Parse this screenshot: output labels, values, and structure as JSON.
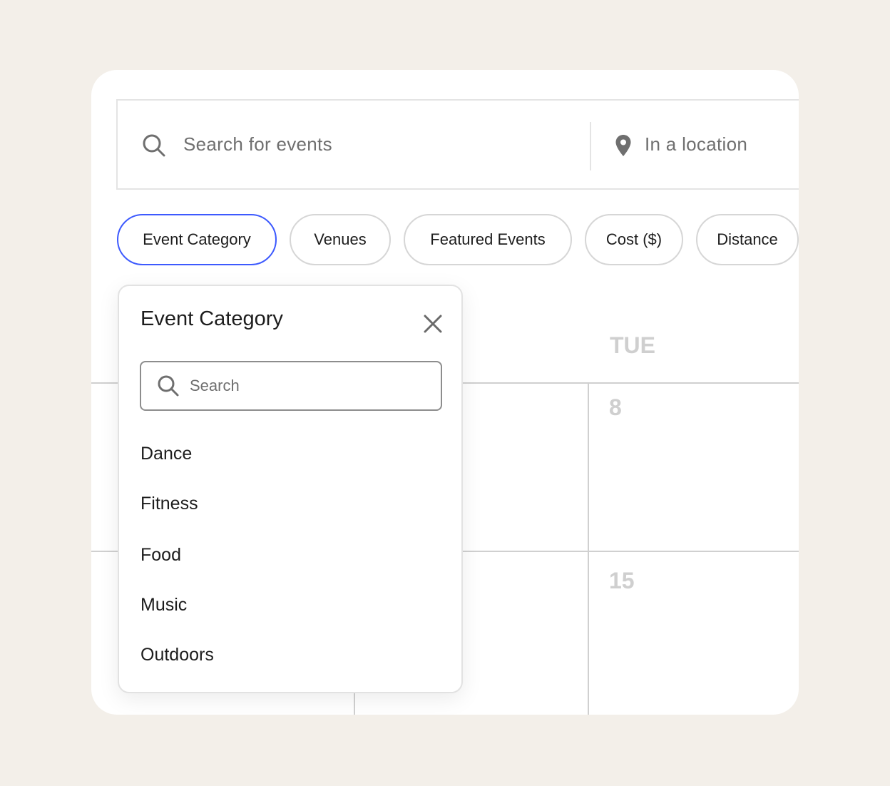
{
  "search": {
    "placeholder": "Search for events",
    "location_placeholder": "In a location"
  },
  "filters": [
    {
      "label": "Event Category",
      "active": true
    },
    {
      "label": "Venues"
    },
    {
      "label": "Featured Events"
    },
    {
      "label": "Cost ($)"
    },
    {
      "label": "Distance"
    }
  ],
  "calendar": {
    "day_header": "TUE",
    "dates": [
      "8",
      "15"
    ]
  },
  "popup": {
    "title": "Event Category",
    "search_placeholder": "Search",
    "items": [
      "Dance",
      "Fitness",
      "Food",
      "Music",
      "Outdoors"
    ]
  },
  "colors": {
    "accent": "#3d5afe",
    "background": "#f3efe9"
  }
}
